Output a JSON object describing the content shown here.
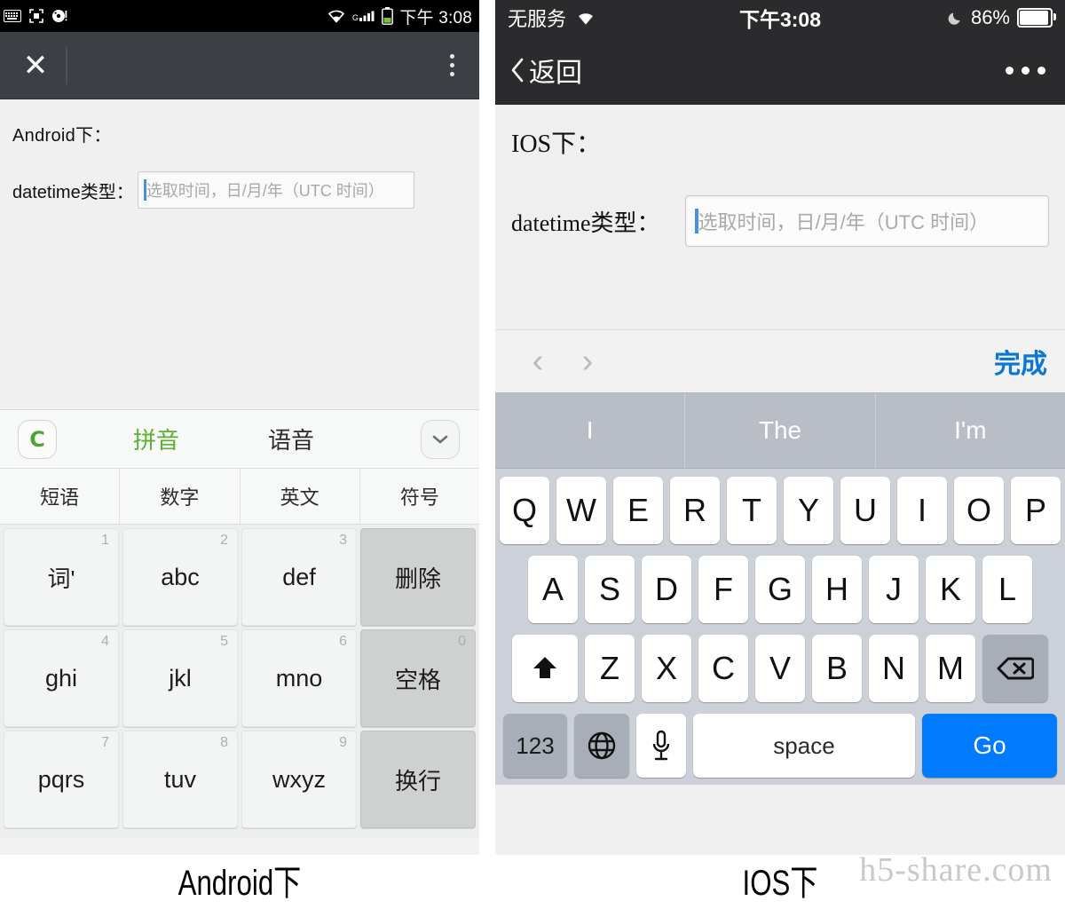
{
  "android": {
    "statusbar": {
      "icons": [
        "keyboard-icon",
        "screenshot-icon",
        "disc-alert-icon",
        "wifi-icon",
        "signal-icon",
        "battery-icon"
      ],
      "signal_label": "G",
      "time": "下午 3:08"
    },
    "toolbar": {
      "close_label": "✕",
      "menu_label": "more-options"
    },
    "content": {
      "heading": "Android下：",
      "field_label": "datetime类型：",
      "placeholder": "选取时间，日/月/年（UTC 时间）",
      "value": ""
    },
    "keyboard": {
      "logo_label": "C",
      "tabs": [
        {
          "label": "拼音",
          "active": true
        },
        {
          "label": "语音",
          "active": false
        }
      ],
      "collapse_icon": "chevron-down-icon",
      "categories": [
        "短语",
        "数字",
        "英文",
        "符号"
      ],
      "rows": [
        [
          {
            "main": "词'",
            "num": "1",
            "fn": false
          },
          {
            "main": "abc",
            "num": "2",
            "fn": false
          },
          {
            "main": "def",
            "num": "3",
            "fn": false
          },
          {
            "main": "删除",
            "num": "",
            "fn": true
          }
        ],
        [
          {
            "main": "ghi",
            "num": "4",
            "fn": false
          },
          {
            "main": "jkl",
            "num": "5",
            "fn": false
          },
          {
            "main": "mno",
            "num": "6",
            "fn": false
          },
          {
            "main": "空格",
            "num": "0",
            "fn": true
          }
        ],
        [
          {
            "main": "pqrs",
            "num": "7",
            "fn": false
          },
          {
            "main": "tuv",
            "num": "8",
            "fn": false
          },
          {
            "main": "wxyz",
            "num": "9",
            "fn": false
          },
          {
            "main": "换行",
            "num": "",
            "fn": true
          }
        ]
      ]
    },
    "caption": "Android下"
  },
  "ios": {
    "statusbar": {
      "carrier": "无服务",
      "wifi_icon": "wifi-icon",
      "time": "下午3:08",
      "moon_icon": "moon-icon",
      "battery_percent": "86%"
    },
    "navbar": {
      "back_label": "返回",
      "back_icon": "chevron-left-icon",
      "menu_label": "more-options"
    },
    "content": {
      "heading": "IOS下：",
      "field_label": "datetime类型：",
      "placeholder": "选取时间，日/月/年（UTC 时间）",
      "value": ""
    },
    "accessory": {
      "prev_icon": "chevron-left-icon",
      "next_icon": "chevron-right-icon",
      "done_label": "完成"
    },
    "keyboard": {
      "predictions": [
        "I",
        "The",
        "I'm"
      ],
      "row1": [
        "Q",
        "W",
        "E",
        "R",
        "T",
        "Y",
        "U",
        "I",
        "O",
        "P"
      ],
      "row2": [
        "A",
        "S",
        "D",
        "F",
        "G",
        "H",
        "J",
        "K",
        "L"
      ],
      "row3": [
        "Z",
        "X",
        "C",
        "V",
        "B",
        "N",
        "M"
      ],
      "shift_icon": "shift-arrow-icon",
      "delete_icon": "backspace-icon",
      "numbers_label": "123",
      "globe_icon": "globe-icon",
      "mic_icon": "microphone-icon",
      "space_label": "space",
      "go_label": "Go"
    },
    "caption": "IOS下"
  },
  "watermark": "h5-share.com",
  "colors": {
    "android_statusbar": "#000000",
    "android_toolbar": "#3c3f44",
    "pinyin_green": "#5cb030",
    "ios_navbar": "#2b2b2e",
    "ios_done_blue": "#0a76d6",
    "ios_go_blue": "#007aff",
    "ios_keyboard_bg": "#ccd0d8"
  }
}
